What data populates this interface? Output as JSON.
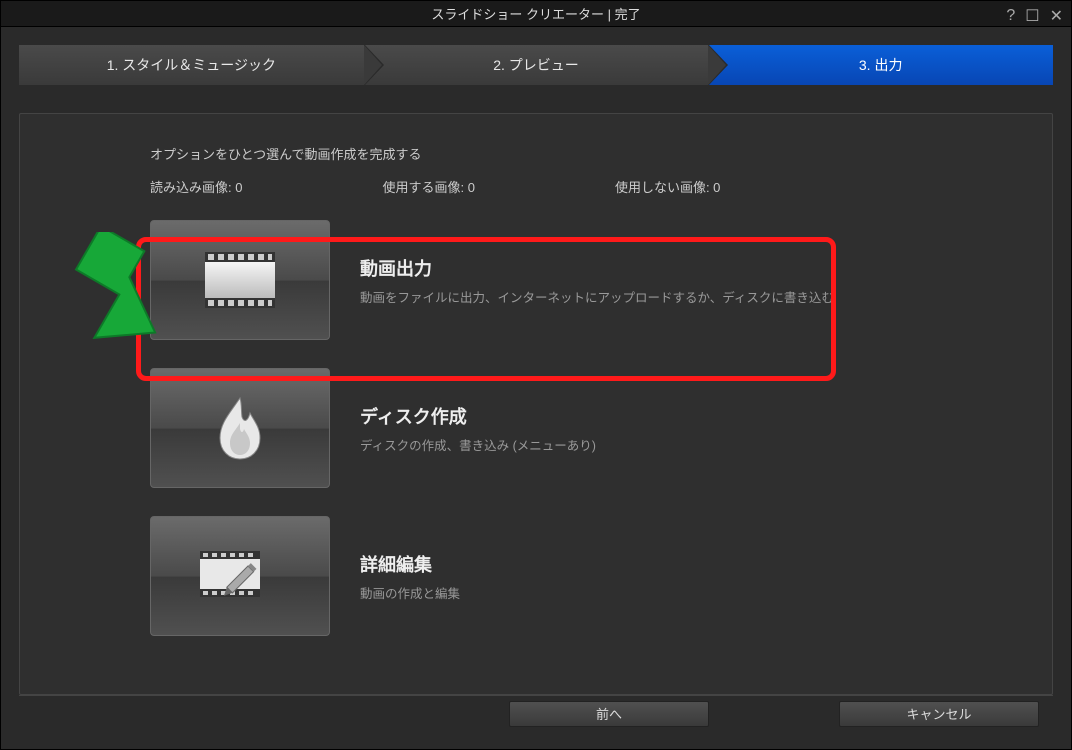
{
  "title": "スライドショー クリエーター | 完了",
  "steps": {
    "s1": "1. スタイル＆ミュージック",
    "s2": "2. プレビュー",
    "s3": "3. 出力"
  },
  "instruction": "オプションをひとつ選んで動画作成を完成する",
  "counts": {
    "loaded": "読み込み画像: 0",
    "used": "使用する画像: 0",
    "unused": "使用しない画像: 0"
  },
  "options": {
    "video": {
      "title": "動画出力",
      "desc": "動画をファイルに出力、インターネットにアップロードするか、ディスクに書き込む"
    },
    "disc": {
      "title": "ディスク作成",
      "desc": "ディスクの作成、書き込み (メニューあり)"
    },
    "edit": {
      "title": "詳細編集",
      "desc": "動画の作成と編集"
    }
  },
  "footer": {
    "prev": "前へ",
    "cancel": "キャンセル"
  }
}
